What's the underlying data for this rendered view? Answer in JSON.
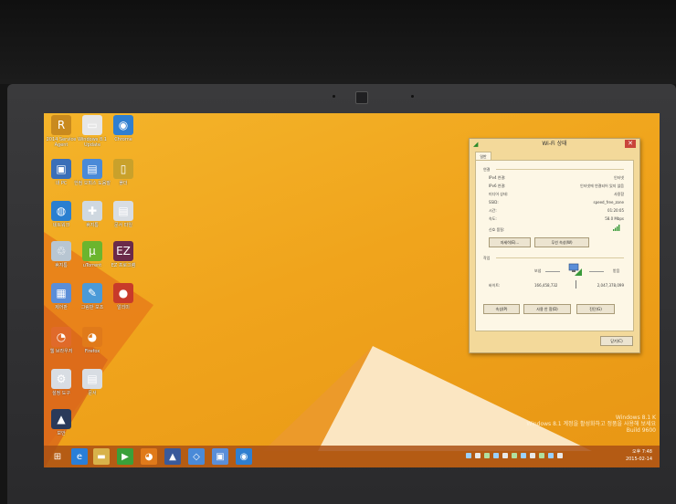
{
  "desktop": {
    "icons": [
      {
        "label": "2014 Service Agent",
        "color": "#c98a1e",
        "glyph": "R"
      },
      {
        "label": "Windows 8.1 Update",
        "color": "#e6e6e6",
        "glyph": "▭"
      },
      {
        "label": "Chrome",
        "color": "#2f7fd0",
        "glyph": "◉"
      },
      {
        "label": "내 PC",
        "color": "#3a6fb8",
        "glyph": "▣"
      },
      {
        "label": "한컴 오피스 도움말",
        "color": "#4a8ad8",
        "glyph": "▤"
      },
      {
        "label": "폴더",
        "color": "#c9a12b",
        "glyph": "▯"
      },
      {
        "label": "네트워크",
        "color": "#2a7fd0",
        "glyph": "◍"
      },
      {
        "label": "휴지통",
        "color": "#cfd8e0",
        "glyph": "✚"
      },
      {
        "label": "문서 파일",
        "color": "#d8dde3",
        "glyph": "▤"
      },
      {
        "label": "휴지통",
        "color": "#b8c6d2",
        "glyph": "♲"
      },
      {
        "label": "uTorrent",
        "color": "#6bb52e",
        "glyph": "μ"
      },
      {
        "label": "EZ 프로그램",
        "color": "#6b2a4a",
        "glyph": "EZ"
      },
      {
        "label": "제어판",
        "color": "#5a8ed8",
        "glyph": "▦"
      },
      {
        "label": "그림판 보조",
        "color": "#4a9ad8",
        "glyph": "✎"
      },
      {
        "label": "알리미",
        "color": "#c83a2a",
        "glyph": "●"
      },
      {
        "label": "웹 브라우저",
        "color": "#e06a2a",
        "glyph": "◔"
      },
      {
        "label": "Firefox",
        "color": "#e07a1a",
        "glyph": "◕"
      },
      {
        "label": "설정 도구",
        "color": "#d8dde3",
        "glyph": "⚙"
      },
      {
        "label": "문서",
        "color": "#d8dde3",
        "glyph": "▤"
      },
      {
        "label": "보안",
        "color": "#2a3a5a",
        "glyph": "▲"
      }
    ]
  },
  "taskbar": {
    "items": [
      {
        "name": "start",
        "glyph": "⊞",
        "color": "#00000000"
      },
      {
        "name": "ie",
        "glyph": "e",
        "color": "#2a7fd8"
      },
      {
        "name": "explorer",
        "glyph": "▬",
        "color": "#d8b24a"
      },
      {
        "name": "store",
        "glyph": "▶",
        "color": "#3aa03a"
      },
      {
        "name": "firefox",
        "glyph": "◕",
        "color": "#e07a1a"
      },
      {
        "name": "app-5",
        "glyph": "▲",
        "color": "#3a5a9a"
      },
      {
        "name": "app-6",
        "glyph": "◇",
        "color": "#4a8ad8"
      },
      {
        "name": "app-7",
        "glyph": "▣",
        "color": "#5a8ed8"
      },
      {
        "name": "chrome",
        "glyph": "◉",
        "color": "#2f7fd0"
      }
    ],
    "clock_time": "오후 7:48",
    "clock_date": "2015-02-14"
  },
  "watermark": {
    "line1": "Windows 8.1 K",
    "line2": "Windows 8.1 계정을 활성화하고 정품을 사용해 보세요",
    "line3": "Build 9600"
  },
  "wifi_dialog": {
    "title": "Wi-Fi 상태",
    "tab": "일반",
    "connection_header": "연결",
    "rows": [
      {
        "label": "IPv4 연결:",
        "value": "인터넷"
      },
      {
        "label": "IPv6 연결:",
        "value": "인터넷에 연결되어 있지 않음"
      },
      {
        "label": "미디어 상태:",
        "value": "사용함"
      },
      {
        "label": "SSID:",
        "value": "speed_free_zone"
      },
      {
        "label": "시간:",
        "value": "01:20:05"
      },
      {
        "label": "속도:",
        "value": "58.0 Mbps"
      }
    ],
    "signal_label": "신호 품질:",
    "details_button": "자세히(E)...",
    "wireless_props_button": "무선 속성(W)",
    "activity_header": "작업",
    "sent_label": "보냄",
    "received_label": "받음",
    "bytes_label": "바이트:",
    "bytes_sent": "166,458,732",
    "bytes_received": "2,047,378,099",
    "properties_button": "속성(P)",
    "disable_button": "사용 안 함(D)",
    "diagnose_button": "진단(G)",
    "close_button": "닫기(C)"
  }
}
